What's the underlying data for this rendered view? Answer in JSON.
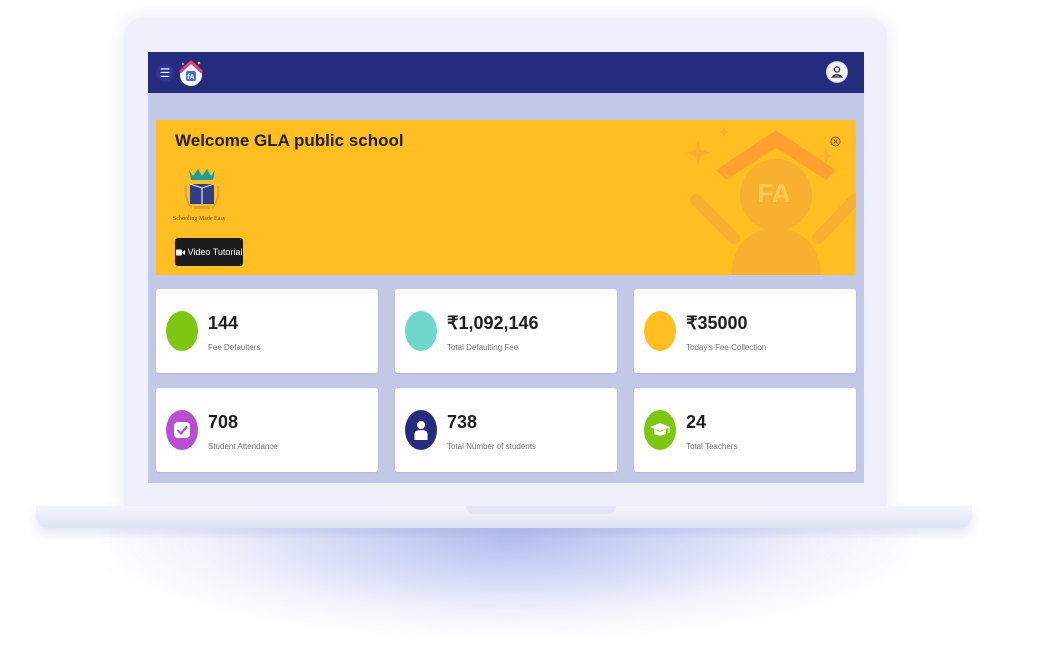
{
  "topbar": {
    "menu_icon": "hamburger-icon",
    "logo_icon": "school-house-logo-icon",
    "profile_icon": "user-avatar-icon",
    "bar_color": "#262c7d"
  },
  "banner": {
    "title": "Welcome GLA public school",
    "school_logo_caption": "Schooling Made Easy",
    "video_button_label": "Video Tutorial",
    "background_color": "#ffbf22"
  },
  "cards": [
    {
      "value": "144",
      "label": "Fee Defaulters",
      "icon": "none",
      "color": "#7dc612"
    },
    {
      "value": "₹1,092,146",
      "label": "Total Defaulting Fee",
      "icon": "none",
      "color": "#6fd6cc"
    },
    {
      "value": "₹35000",
      "label": "Today's Fee Collection",
      "icon": "none",
      "color": "#ffbf22"
    },
    {
      "value": "708",
      "label": "Student Attendance",
      "icon": "check-icon",
      "color": "#b84fd3"
    },
    {
      "value": "738",
      "label": "Total Number of students",
      "icon": "person-icon",
      "color": "#262c7d"
    },
    {
      "value": "24",
      "label": "Total Teachers",
      "icon": "graduation-cap-icon",
      "color": "#7dc612"
    }
  ]
}
